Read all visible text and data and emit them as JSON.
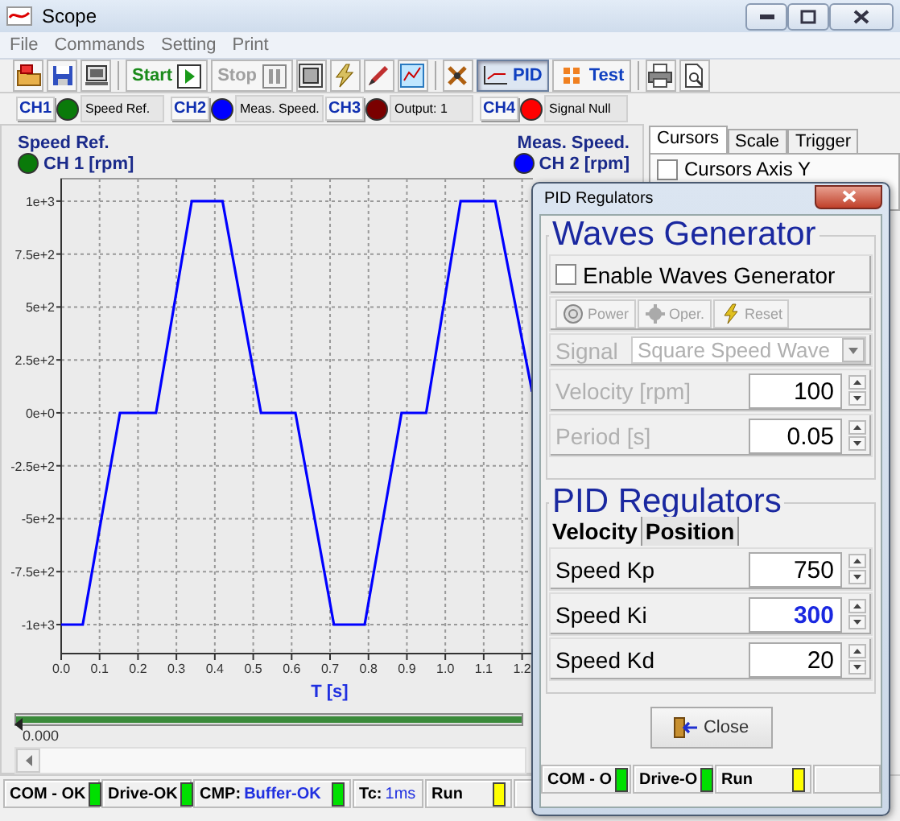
{
  "window": {
    "title": "Scope"
  },
  "menu": [
    "File",
    "Commands",
    "Setting",
    "Print"
  ],
  "toolbar": {
    "buttons": [
      {
        "label": "Start",
        "disabled": false,
        "selected": false
      },
      {
        "label": "Stop",
        "disabled": true,
        "selected": false
      },
      {
        "label": "PID",
        "disabled": false,
        "selected": true
      },
      {
        "label": "Test",
        "disabled": false,
        "selected": false
      }
    ]
  },
  "channels": [
    {
      "tag": "CH1",
      "color": "#0a7a0a",
      "name": "Speed Ref."
    },
    {
      "tag": "CH2",
      "color": "#0000ff",
      "name": "Meas. Speed."
    },
    {
      "tag": "CH3",
      "color": "#7a0000",
      "name": "Output: 1"
    },
    {
      "tag": "CH4",
      "color": "#ff0000",
      "name": "Signal Null"
    }
  ],
  "scope": {
    "left_axis": {
      "name": "Speed Ref.",
      "channel": "CH 1 [rpm]",
      "color": "#0a7a0a"
    },
    "right_axis": {
      "name": "Meas. Speed.",
      "channel": "CH 2 [rpm]",
      "color": "#0000ff"
    },
    "chart_data": {
      "type": "line",
      "xlabel": "T [s]",
      "x": [
        0,
        0.056,
        0.153,
        0.247,
        0.34,
        0.42,
        0.52,
        0.61,
        0.71,
        0.79,
        0.886,
        0.95,
        1.04,
        1.13,
        1.226
      ],
      "series": [
        {
          "color": "#0000ff",
          "values": [
            -1000,
            -1000,
            0,
            0,
            1000,
            1000,
            0,
            0,
            -1000,
            -1000,
            0,
            0,
            1000,
            1000,
            100
          ]
        }
      ],
      "grid": true,
      "xlim": [
        0,
        1.226
      ],
      "ylim": [
        -1137,
        1106
      ],
      "xticks": [
        {
          "value": 0,
          "label": "0.0"
        },
        {
          "value": 0.1,
          "label": "0.1"
        },
        {
          "value": 0.2,
          "label": "0.2"
        },
        {
          "value": 0.3,
          "label": "0.3"
        },
        {
          "value": 0.4,
          "label": "0.4"
        },
        {
          "value": 0.5,
          "label": "0.5"
        },
        {
          "value": 0.6,
          "label": "0.6"
        },
        {
          "value": 0.7,
          "label": "0.7"
        },
        {
          "value": 0.8,
          "label": "0.8"
        },
        {
          "value": 0.9,
          "label": "0.9"
        },
        {
          "value": 1,
          "label": "1.0"
        },
        {
          "value": 1.1,
          "label": "1.1"
        },
        {
          "value": 1.2,
          "label": "1.2"
        }
      ],
      "yticks": [
        {
          "value": 1000,
          "label": "1e+3"
        },
        {
          "value": 750,
          "label": "7.5e+2"
        },
        {
          "value": 500,
          "label": "5e+2"
        },
        {
          "value": 250,
          "label": "2.5e+2"
        },
        {
          "value": 0,
          "label": "0e+0"
        },
        {
          "value": -250,
          "label": "-2.5e+2"
        },
        {
          "value": -500,
          "label": "-5e+2"
        },
        {
          "value": -750,
          "label": "-7.5e+2"
        },
        {
          "value": -1000,
          "label": "-1e+3"
        }
      ]
    },
    "cursor_slider": {
      "level": 0,
      "reading": "0.000"
    }
  },
  "side_panel": {
    "tabs": [
      {
        "label": "Cursors",
        "selected": true
      },
      {
        "label": "Scale",
        "selected": false
      },
      {
        "label": "Trigger",
        "selected": false
      }
    ],
    "cursors_axis_y": {
      "label": "Cursors Axis Y",
      "checked": false
    }
  },
  "status_bar": [
    {
      "label": "COM - OK",
      "color": "#00e000"
    },
    {
      "label": "Drive-OK",
      "color": "#00e000"
    },
    {
      "label": "CMP:",
      "value": "Buffer-OK",
      "color": "#00e000"
    },
    {
      "label": "Tc:",
      "value": "1ms"
    },
    {
      "label": "Run",
      "color": "#ffff00"
    }
  ],
  "pid_dialog": {
    "title": "PID Regulators",
    "waves_generator": {
      "title": "Waves Generator",
      "enable": {
        "label": "Enable Waves Generator",
        "checked": false
      },
      "buttons": [
        {
          "label": "Power",
          "disabled": true
        },
        {
          "label": "Oper.",
          "disabled": true
        },
        {
          "label": "Reset",
          "disabled": true
        }
      ],
      "fields": [
        {
          "kind": "dropdown",
          "label": "Signal",
          "value": "Square Speed Wave",
          "disabled": true
        },
        {
          "kind": "spin",
          "label": "Velocity [rpm]",
          "value": "100",
          "disabled": true
        },
        {
          "kind": "spin",
          "label": "Period [s]",
          "value": "0.05",
          "disabled": true
        }
      ]
    },
    "pid": {
      "title": "PID Regulators",
      "tabs": [
        {
          "label": "Velocity",
          "selected": true
        },
        {
          "label": "Position",
          "selected": false
        }
      ],
      "fields": [
        {
          "label": "Speed Kp",
          "value": "750",
          "focused": false
        },
        {
          "label": "Speed Ki",
          "value": "300",
          "focused": true
        },
        {
          "label": "Speed Kd",
          "value": "20",
          "focused": false
        }
      ]
    },
    "close": "Close",
    "status_bar": [
      {
        "label": "COM - O",
        "color": "#00e000"
      },
      {
        "label": "Drive-O",
        "color": "#00e000"
      },
      {
        "label": "Run",
        "color": "#ffff00"
      }
    ]
  }
}
